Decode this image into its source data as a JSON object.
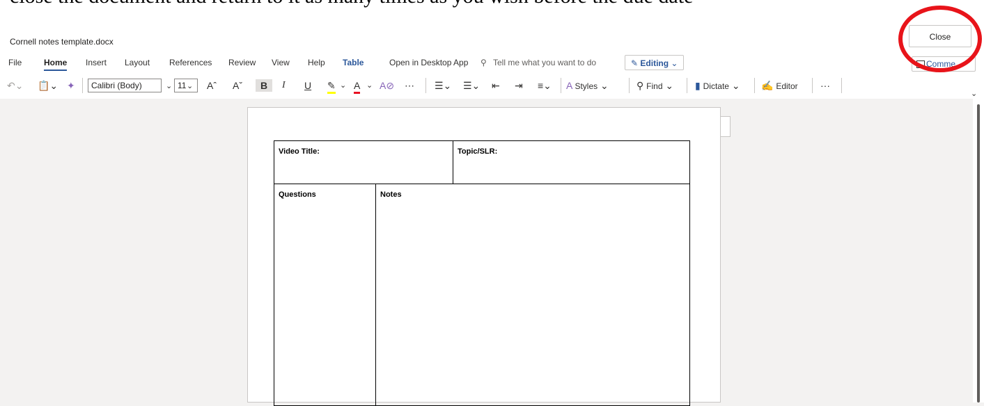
{
  "caption": {
    "text": "close the document and return to it as many times as you wish before the due date"
  },
  "titlebar": {
    "document_name": "Cornell notes template.docx",
    "close_label": "Close"
  },
  "ribbon": {
    "tabs": [
      "File",
      "Home",
      "Insert",
      "Layout",
      "References",
      "Review",
      "View",
      "Help",
      "Table"
    ],
    "open_desktop": "Open in Desktop App",
    "tell_me": "Tell me what you want to do",
    "editing": "Editing",
    "comments": "Comme"
  },
  "toolbar": {
    "font": "Calibri (Body)",
    "size": "11",
    "styles": "Styles",
    "find": "Find",
    "dictate": "Dictate",
    "editor": "Editor",
    "more": "···"
  },
  "document": {
    "video_title": "Video Title:",
    "topic": "Topic/SLR:",
    "questions": "Questions",
    "notes": "Notes"
  },
  "colors": {
    "accent": "#2b579a",
    "highlight": "#ffff00",
    "font_color": "#e81123",
    "annotation": "#e8141a"
  }
}
